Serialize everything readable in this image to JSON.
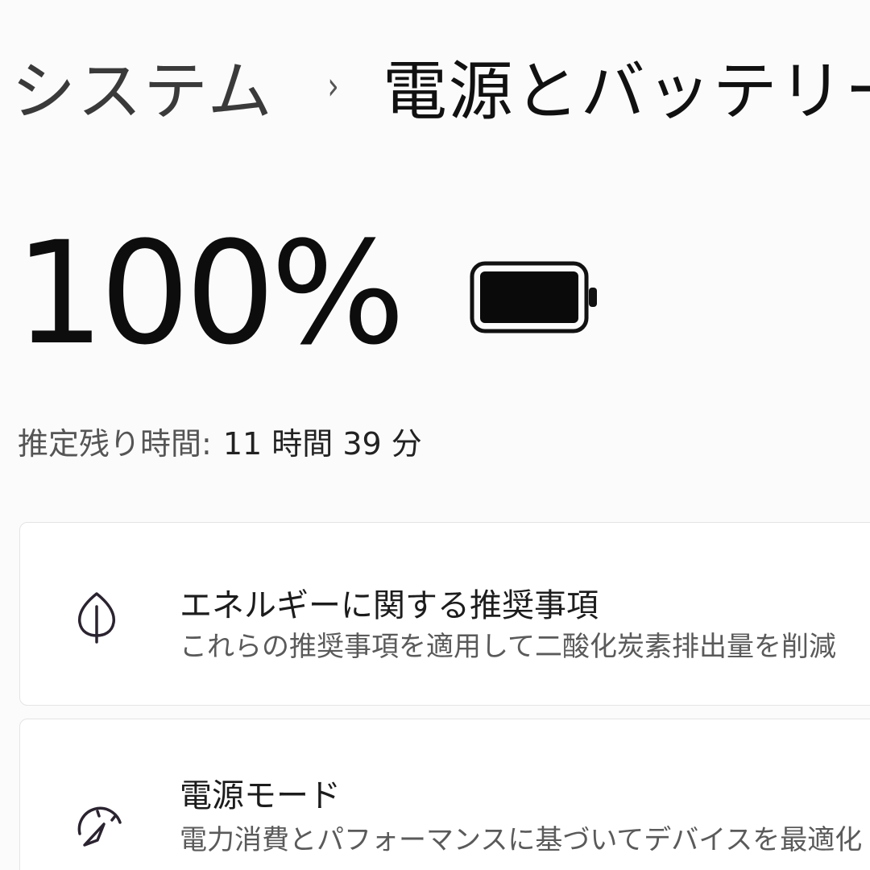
{
  "breadcrumb": {
    "parent": "システム",
    "separator": "›",
    "current": "電源とバッテリー"
  },
  "battery": {
    "percent_text": "100%",
    "level": 100,
    "icon": "battery-full-icon"
  },
  "estimate": {
    "label": "推定残り時間:",
    "value": "11 時間 39 分"
  },
  "cards": [
    {
      "icon": "leaf-icon",
      "title": "エネルギーに関する推奨事項",
      "subtitle": "これらの推奨事項を適用して二酸化炭素排出量を削減"
    },
    {
      "icon": "gauge-icon",
      "title": "電源モード",
      "subtitle": "電力消費とパフォーマンスに基づいてデバイスを最適化"
    }
  ]
}
